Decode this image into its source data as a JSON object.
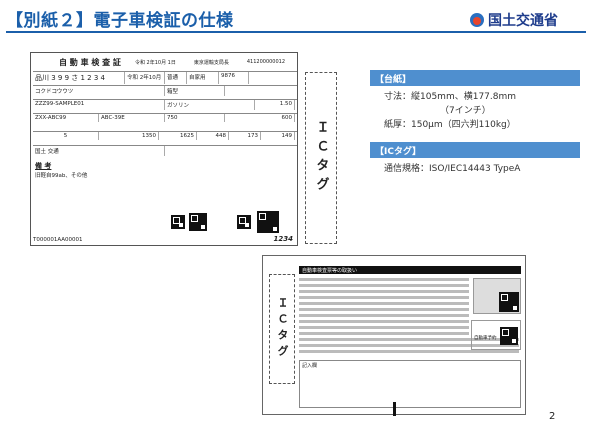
{
  "header": {
    "title": "【別紙２】電子車検証の仕様",
    "logo_text": "国土交通省"
  },
  "front_card": {
    "title": "自 動 車 検 査 証",
    "date": "令和 2年10月 1日",
    "office": "東京運輸支局長",
    "cert_no": "411200000012",
    "plate": "品川 3 9 9 さ 1 2 3 4",
    "reg_date": "令和 2年10月",
    "use": "普通",
    "purpose": "自家用",
    "capacity": "9876",
    "car_name": "コクドコウウツ",
    "body_label": "箱型",
    "model": "ZZZ99-SAMPLE01",
    "fuel": "ガソリン",
    "displacement": "1.50",
    "chassis": "ZXX-ABC99",
    "chassis2": "ABC-39E",
    "weight": "750",
    "seats": "600",
    "dims": [
      "5",
      "1350",
      "1625",
      "448",
      "173",
      "149"
    ],
    "owner": "国土 交通",
    "remarks_label": "備 考",
    "remarks_text": "旧軽自99ab、その他",
    "footer_no": "T000001AA00001",
    "footer_code": "1234",
    "ic_label": "ＩＣタグ"
  },
  "spec": {
    "base_head": "【台紙】",
    "size_line": "寸法：縦105mm、横177.8mm",
    "inch_line": "（7インチ）",
    "paper_line": "紙厚：150μm（四六判110kg）",
    "ic_head": "【ICタグ】",
    "ic_line": "通信規格：ISO/IEC14443 TypeA"
  },
  "back_card": {
    "note_head": "自動車検査票等の取扱い",
    "ic_label": "ＩＣタグ",
    "sub_label": "自動車予約",
    "memo_label": "記入欄"
  },
  "page_number": "2"
}
